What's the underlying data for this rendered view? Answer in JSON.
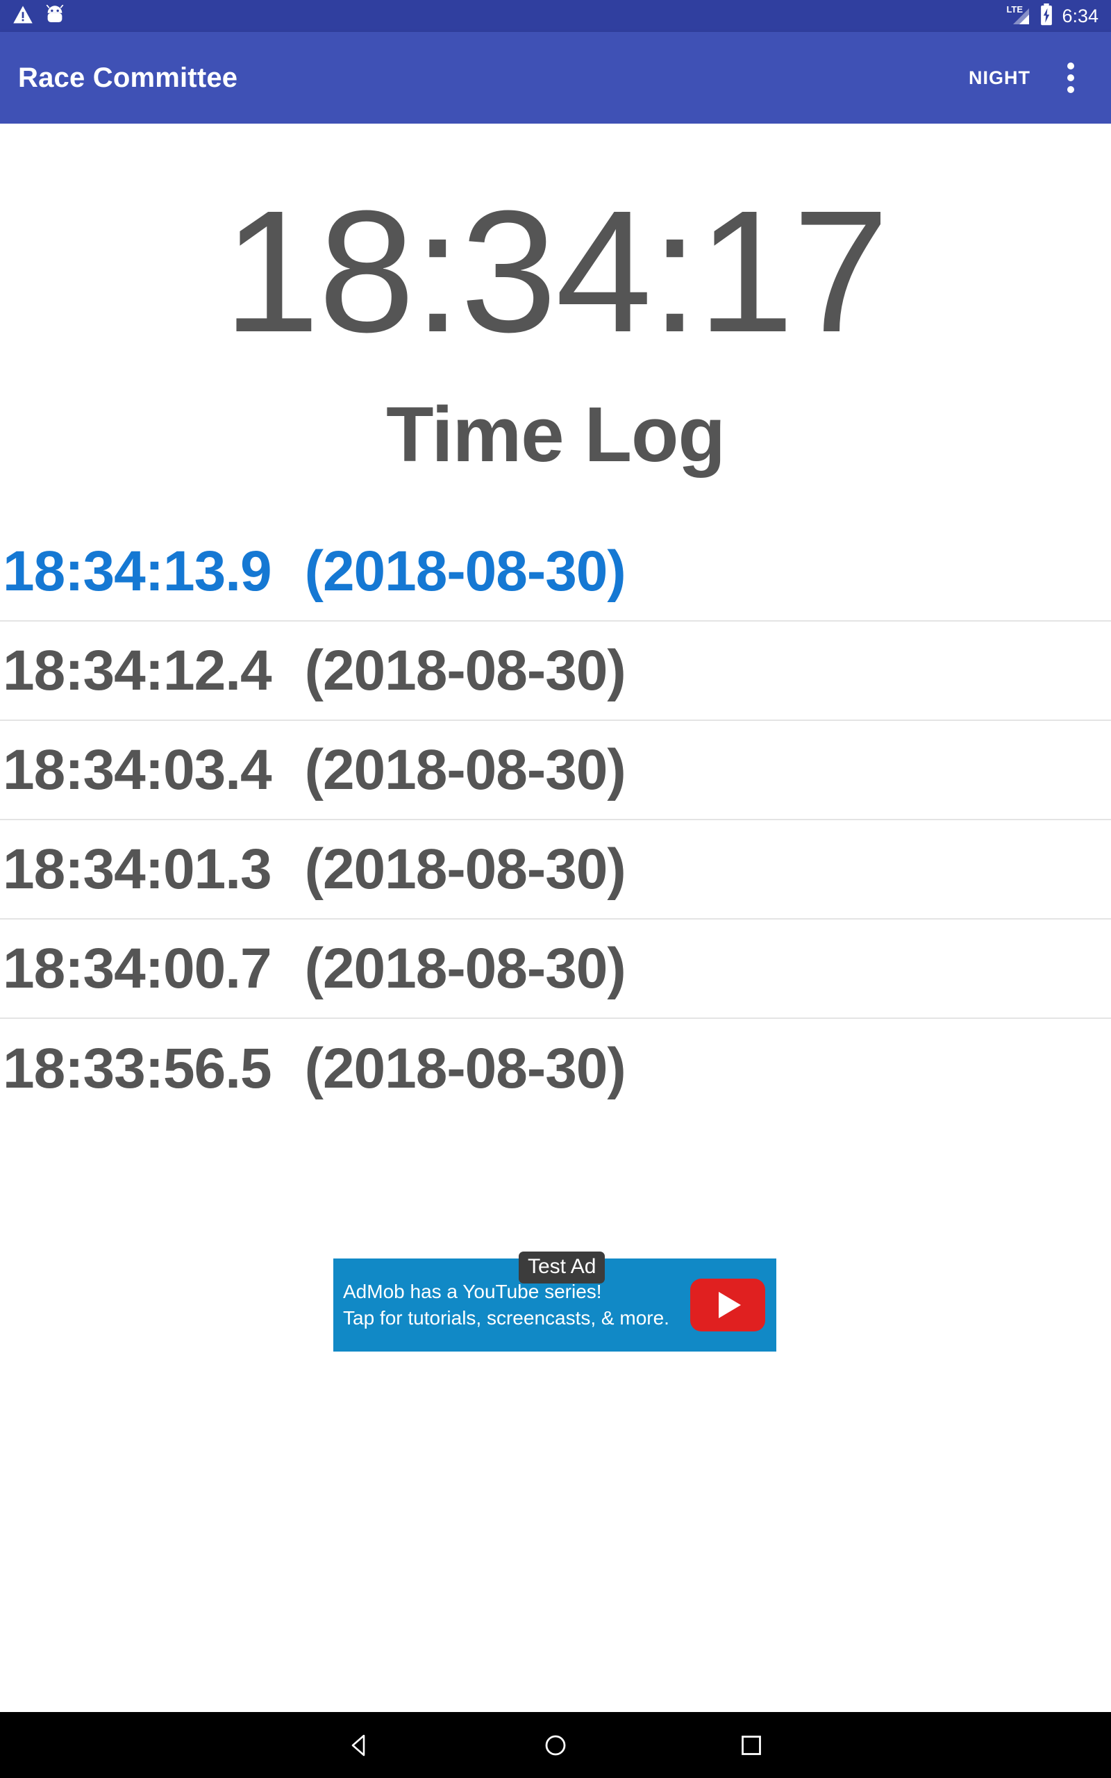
{
  "status_bar": {
    "icons": [
      "warning-triangle-icon",
      "android-robot-icon"
    ],
    "network_label": "LTE",
    "battery_state": "charging",
    "clock": "6:34"
  },
  "app_bar": {
    "title": "Race Committee",
    "night_label": "NIGHT",
    "overflow_label": "more-options"
  },
  "main": {
    "current_time": "18:34:17",
    "section_title": "Time Log",
    "log_entries": [
      {
        "time": "18:34:13.9",
        "date": "(2018-08-30)",
        "selected": true
      },
      {
        "time": "18:34:12.4",
        "date": "(2018-08-30)",
        "selected": false
      },
      {
        "time": "18:34:03.4",
        "date": "(2018-08-30)",
        "selected": false
      },
      {
        "time": "18:34:01.3",
        "date": "(2018-08-30)",
        "selected": false
      },
      {
        "time": "18:34:00.7",
        "date": "(2018-08-30)",
        "selected": false
      },
      {
        "time": "18:33:56.5",
        "date": "(2018-08-30)",
        "selected": false
      }
    ]
  },
  "ad": {
    "badge": "Test Ad",
    "line1": "AdMob has a YouTube series!",
    "line2": "Tap for tutorials, screencasts, & more.",
    "cta_icon": "youtube-play-icon"
  },
  "nav_bar": {
    "back": "back-button",
    "home": "home-button",
    "recents": "recents-button"
  },
  "colors": {
    "status_bar": "#303f9f",
    "app_bar": "#3f51b5",
    "selected_entry": "#1578d3",
    "text_gray": "#555555",
    "ad_background": "#1189c6",
    "ad_badge": "#3c3c3c",
    "youtube_red": "#e02020",
    "divider": "#e4e4e4"
  }
}
